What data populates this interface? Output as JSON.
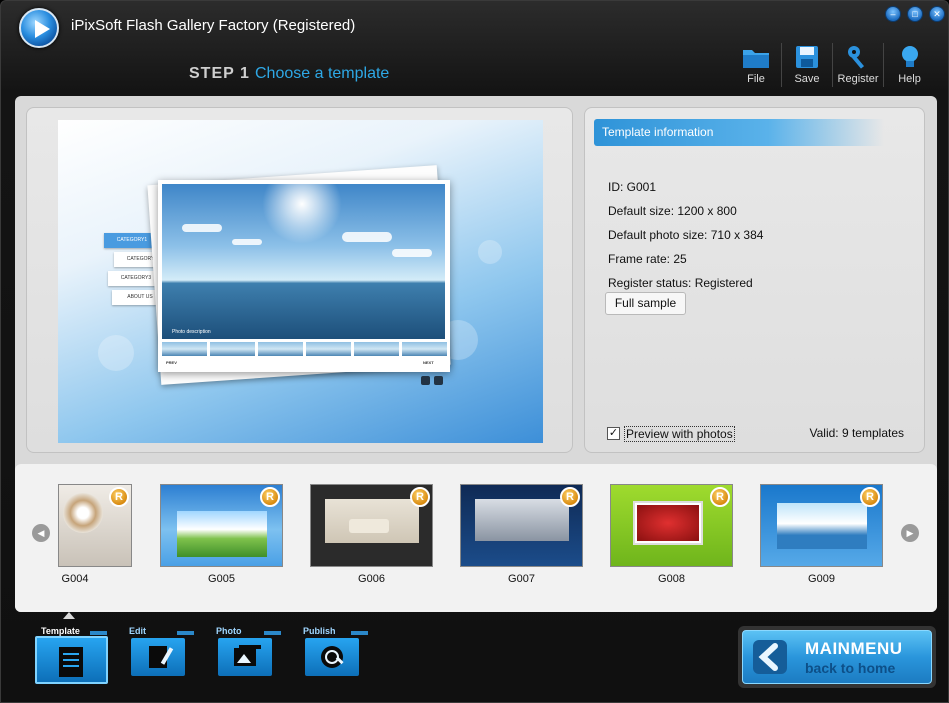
{
  "window": {
    "title": "iPixSoft Flash Gallery Factory (Registered)",
    "controls": [
      {
        "name": "minimize-icon",
        "glyph": "–"
      },
      {
        "name": "maximize-icon",
        "glyph": "□"
      },
      {
        "name": "close-icon",
        "glyph": "✕"
      }
    ]
  },
  "step": {
    "number": "STEP 1",
    "title": "Choose a template"
  },
  "toolbar": {
    "file": "File",
    "save": "Save",
    "register": "Register",
    "help": "Help"
  },
  "preview": {
    "categories": [
      "CATEGORY1",
      "CATEGORY2",
      "CATEGORY3",
      "ABOUT US"
    ],
    "photo_description": "Photo description",
    "prev": "PREV",
    "next": "NEXT"
  },
  "template_info": {
    "header": "Template information",
    "id": "ID: G001",
    "default_size": "Default size: 1200 x 800",
    "default_photo_size": "Default photo size: 710 x 384",
    "frame_rate": "Frame rate: 25",
    "register_status": "Register status: Registered",
    "full_sample": "Full sample",
    "preview_with_photos": "Preview with photos",
    "preview_checked": "✓",
    "valid": "Valid: 9 templates"
  },
  "templates": [
    {
      "id": "G004",
      "badge": "R"
    },
    {
      "id": "G005",
      "badge": "R"
    },
    {
      "id": "G006",
      "badge": "R"
    },
    {
      "id": "G007",
      "badge": "R"
    },
    {
      "id": "G008",
      "badge": "R"
    },
    {
      "id": "G009",
      "badge": "R"
    }
  ],
  "scroll": {
    "left": "◀",
    "right": "▶"
  },
  "bottom_tabs": {
    "template": "Template",
    "edit": "Edit",
    "photo": "Photo",
    "publish": "Publish"
  },
  "mainmenu": {
    "title": "MAINMENU",
    "subtitle": "back to home"
  }
}
